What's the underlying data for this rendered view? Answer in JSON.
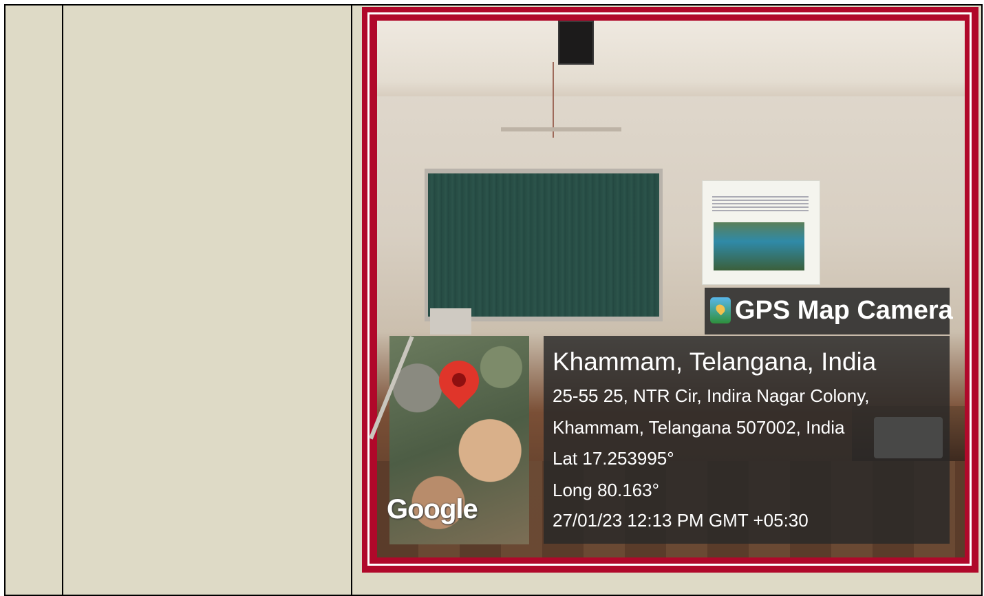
{
  "photo_overlay": {
    "app_name": "GPS Map Camera",
    "location_title": "Khammam, Telangana, India",
    "address_line1": "25-55 25, NTR Cir, Indira Nagar Colony,",
    "address_line2": "Khammam, Telangana 507002, India",
    "latitude": "Lat 17.253995°",
    "longitude": "Long 80.163°",
    "timestamp": "27/01/23 12:13 PM GMT +05:30",
    "map_brand": "Google",
    "icon": "map-pin-icon"
  },
  "colors": {
    "frame": "#b0082a",
    "cell_background": "#dedac6"
  }
}
